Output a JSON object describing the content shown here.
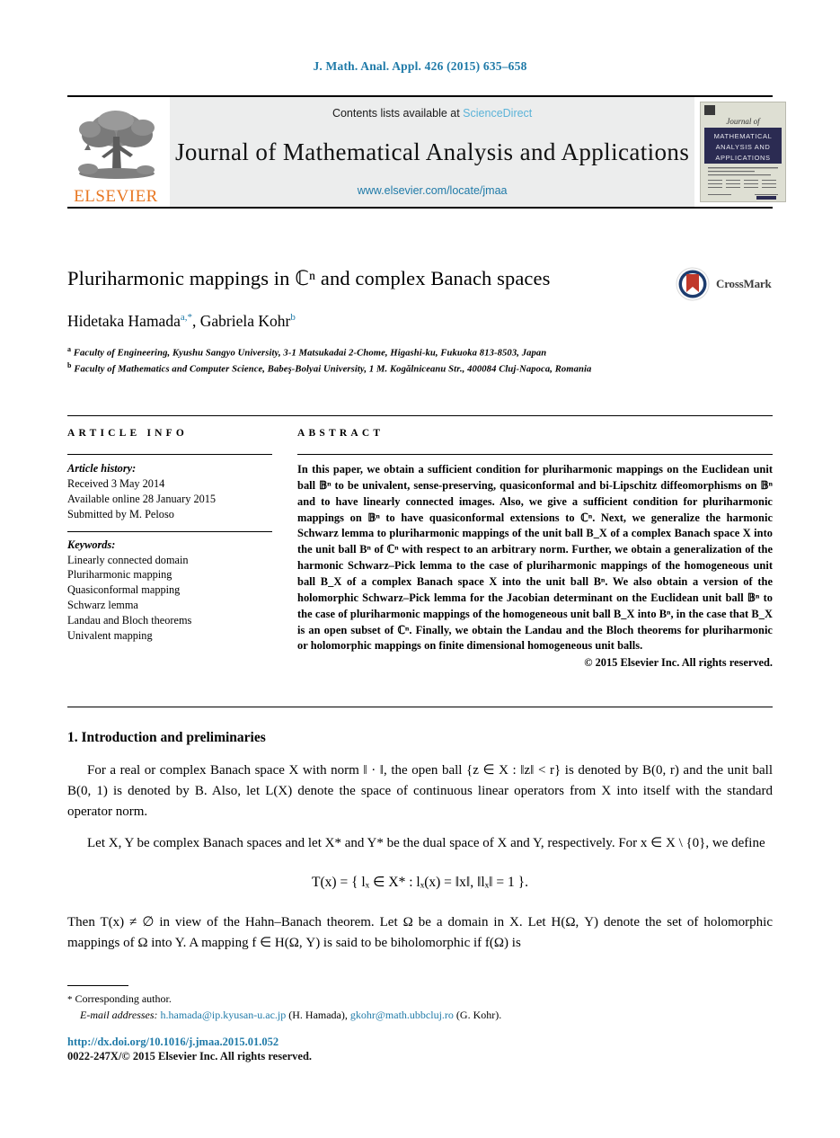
{
  "running_head": "J. Math. Anal. Appl. 426 (2015) 635–658",
  "masthead": {
    "publisher_name": "ELSEVIER",
    "contents_prefix": "Contents lists available at ",
    "contents_link": "ScienceDirect",
    "journal_name": "Journal of Mathematical Analysis and Applications",
    "journal_url": "www.elsevier.com/locate/jmaa",
    "cover": {
      "line1": "Journal of",
      "line2": "MATHEMATICAL",
      "line3": "ANALYSIS AND",
      "line4": "APPLICATIONS"
    }
  },
  "article": {
    "title": "Pluriharmonic mappings in ℂⁿ and complex Banach spaces",
    "authors": [
      {
        "name": "Hidetaka Hamada",
        "marks": "a,*"
      },
      {
        "name": "Gabriela Kohr",
        "marks": "b"
      }
    ],
    "affiliations": [
      {
        "mark": "a",
        "text": "Faculty of Engineering, Kyushu Sangyo University, 3-1 Matsukadai 2-Chome, Higashi-ku, Fukuoka 813-8503, Japan"
      },
      {
        "mark": "b",
        "text": "Faculty of Mathematics and Computer Science, Babeş-Bolyai University, 1 M. Kogălniceanu Str., 400084 Cluj-Napoca, Romania"
      }
    ],
    "crossmark_label": "CrossMark"
  },
  "article_info": {
    "heading": "ARTICLE INFO",
    "history_title": "Article history:",
    "history": [
      "Received 3 May 2014",
      "Available online 28 January 2015",
      "Submitted by M. Peloso"
    ],
    "keywords_title": "Keywords:",
    "keywords": [
      "Linearly connected domain",
      "Pluriharmonic mapping",
      "Quasiconformal mapping",
      "Schwarz lemma",
      "Landau and Bloch theorems",
      "Univalent mapping"
    ]
  },
  "abstract": {
    "heading": "ABSTRACT",
    "text": "In this paper, we obtain a sufficient condition for pluriharmonic mappings on the Euclidean unit ball 𝔹ⁿ to be univalent, sense-preserving, quasiconformal and bi-Lipschitz diffeomorphisms on 𝔹ⁿ and to have linearly connected images. Also, we give a sufficient condition for pluriharmonic mappings on 𝔹ⁿ to have quasiconformal extensions to ℂⁿ. Next, we generalize the harmonic Schwarz lemma to pluriharmonic mappings of the unit ball B_X of a complex Banach space X into the unit ball Bⁿ of ℂⁿ with respect to an arbitrary norm. Further, we obtain a generalization of the harmonic Schwarz–Pick lemma to the case of pluriharmonic mappings of the homogeneous unit ball B_X of a complex Banach space X into the unit ball Bⁿ. We also obtain a version of the holomorphic Schwarz–Pick lemma for the Jacobian determinant on the Euclidean unit ball 𝔹ⁿ to the case of pluriharmonic mappings of the homogeneous unit ball B_X into Bⁿ, in the case that B_X is an open subset of ℂⁿ. Finally, we obtain the Landau and the Bloch theorems for pluriharmonic or holomorphic mappings on finite dimensional homogeneous unit balls.",
    "copyright": "© 2015 Elsevier Inc. All rights reserved."
  },
  "body": {
    "section_heading": "1. Introduction and preliminaries",
    "paragraph_1": "For a real or complex Banach space X with norm ‖ · ‖, the open ball {z ∈ X : ‖z‖ < r} is denoted by B(0, r) and the unit ball B(0, 1) is denoted by B. Also, let L(X) denote the space of continuous linear operators from X into itself with the standard operator norm.",
    "paragraph_2": "Let X, Y be complex Banach spaces and let X* and Y* be the dual space of X and Y, respectively. For x ∈ X \\ {0}, we define",
    "equation": "T(x) = { lₓ ∈ X* :  lₓ(x) = ‖x‖,  ‖lₓ‖ = 1 }.",
    "paragraph_3": "Then T(x) ≠ ∅ in view of the Hahn–Banach theorem. Let Ω be a domain in X. Let H(Ω, Y) denote the set of holomorphic mappings of Ω into Y. A mapping f ∈ H(Ω, Y) is said to be biholomorphic if f(Ω) is"
  },
  "footer": {
    "corresponding_author": "Corresponding author.",
    "email_label": "E-mail addresses:",
    "email_1": "h.hamada@ip.kyusan-u.ac.jp",
    "email_1_owner": "(H. Hamada),",
    "email_2": "gkohr@math.ubbcluj.ro",
    "email_2_owner": "(G. Kohr).",
    "doi": "http://dx.doi.org/10.1016/j.jmaa.2015.01.052",
    "issn": "0022-247X/© 2015 Elsevier Inc. All rights reserved."
  },
  "colors": {
    "link_blue": "#1f7aa8",
    "sciencedirect_blue": "#5bb3d8",
    "elsevier_orange": "#E87722",
    "crossmark_red": "#c0392b",
    "crossmark_navy": "#1d3c6e"
  }
}
